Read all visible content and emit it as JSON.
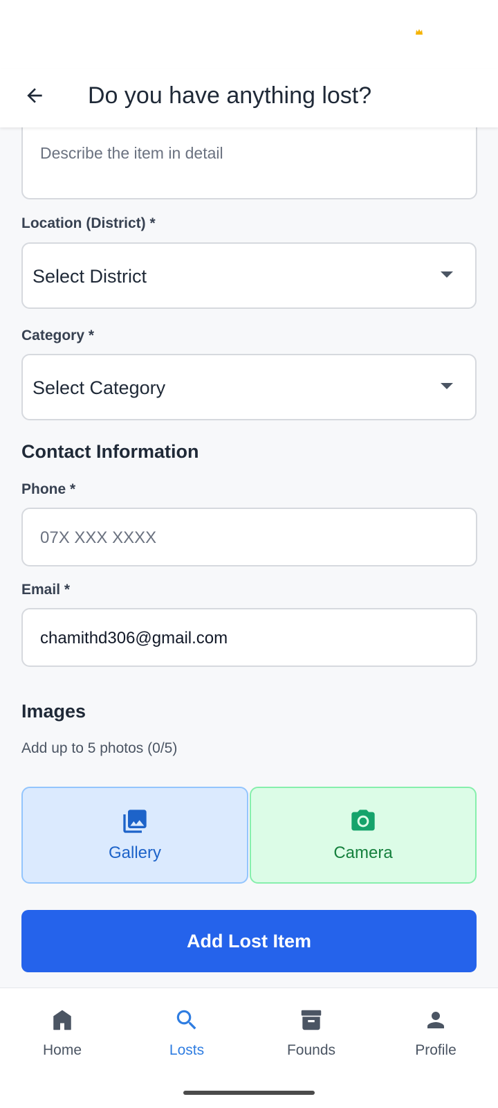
{
  "app_bar": {
    "title": "Do you have anything lost?"
  },
  "form": {
    "description": {
      "placeholder": "Describe the item in detail"
    },
    "location": {
      "label": "Location (District) *",
      "selected": "Select District"
    },
    "category": {
      "label": "Category *",
      "selected": "Select Category"
    },
    "contact_section_title": "Contact Information",
    "phone": {
      "label": "Phone *",
      "placeholder": "07X XXX XXXX"
    },
    "email": {
      "label": "Email *",
      "value": "chamithd306@gmail.com"
    },
    "images": {
      "title": "Images",
      "hint": "Add up to 5 photos (0/5)",
      "gallery_label": "Gallery",
      "camera_label": "Camera"
    },
    "submit_label": "Add Lost Item"
  },
  "bottom_nav": {
    "items": [
      {
        "label": "Home",
        "icon": "home-icon"
      },
      {
        "label": "Losts",
        "icon": "search-icon",
        "active": true
      },
      {
        "label": "Founds",
        "icon": "archive-icon"
      },
      {
        "label": "Profile",
        "icon": "person-icon"
      }
    ]
  },
  "colors": {
    "primary": "#2563eb",
    "active_nav": "#2f7de1",
    "gallery_bg": "#dbeafe",
    "camera_bg": "#dcfce7"
  }
}
